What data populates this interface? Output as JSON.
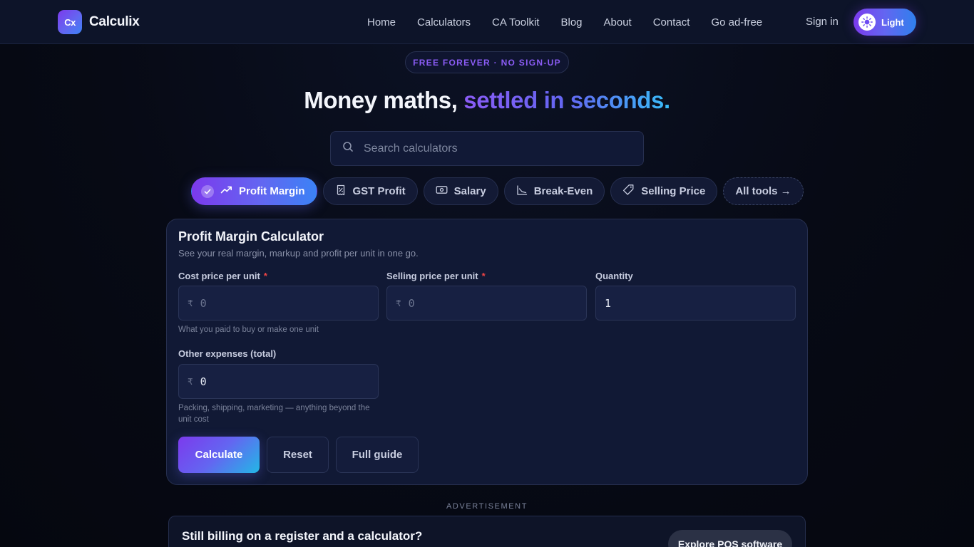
{
  "brand": {
    "mark": "Cx",
    "name": "Calculix"
  },
  "nav": {
    "links": [
      "Home",
      "Calculators",
      "CA Toolkit",
      "Blog",
      "About",
      "Contact",
      "Go ad-free"
    ],
    "signin": "Sign in",
    "theme_toggle": "Light"
  },
  "hero": {
    "badge": "FREE FOREVER · NO SIGN-UP",
    "title_plain": "Money maths, ",
    "title_accent": "settled in seconds."
  },
  "search": {
    "placeholder": "Search calculators",
    "value": ""
  },
  "pills": [
    {
      "label": "Profit Margin",
      "icon": "trending-up-icon",
      "active": true
    },
    {
      "label": "GST Profit",
      "icon": "receipt-percent-icon",
      "active": false
    },
    {
      "label": "Salary",
      "icon": "banknote-icon",
      "active": false
    },
    {
      "label": "Break-Even",
      "icon": "line-chart-icon",
      "active": false
    },
    {
      "label": "Selling Price",
      "icon": "tag-icon",
      "active": false
    }
  ],
  "all_tools": "All tools →",
  "calculator": {
    "title": "Profit Margin Calculator",
    "subtitle": "See your real margin, markup and profit per unit in one go.",
    "currency_symbol": "₹",
    "fields": {
      "cost": {
        "label": "Cost price per unit",
        "required_mark": "*",
        "placeholder": "0",
        "value": "",
        "hint": "What you paid to buy or make one unit"
      },
      "selling": {
        "label": "Selling price per unit",
        "required_mark": "*",
        "placeholder": "0",
        "value": ""
      },
      "quantity": {
        "label": "Quantity",
        "value": "1"
      },
      "expenses": {
        "label": "Other expenses (total)",
        "value": "0",
        "hint": "Packing, shipping, marketing — anything beyond the unit cost"
      }
    },
    "buttons": {
      "calculate": "Calculate",
      "reset": "Reset",
      "guide": "Full guide"
    }
  },
  "ad": {
    "label": "ADVERTISEMENT",
    "title": "Still billing on a register and a calculator?",
    "cta": "Explore POS software"
  },
  "colors": {
    "accent_start": "#7c3aed",
    "accent_mid": "#6366f1",
    "accent_end": "#38bdf8",
    "required": "#ef4444",
    "background": "#070a15"
  }
}
